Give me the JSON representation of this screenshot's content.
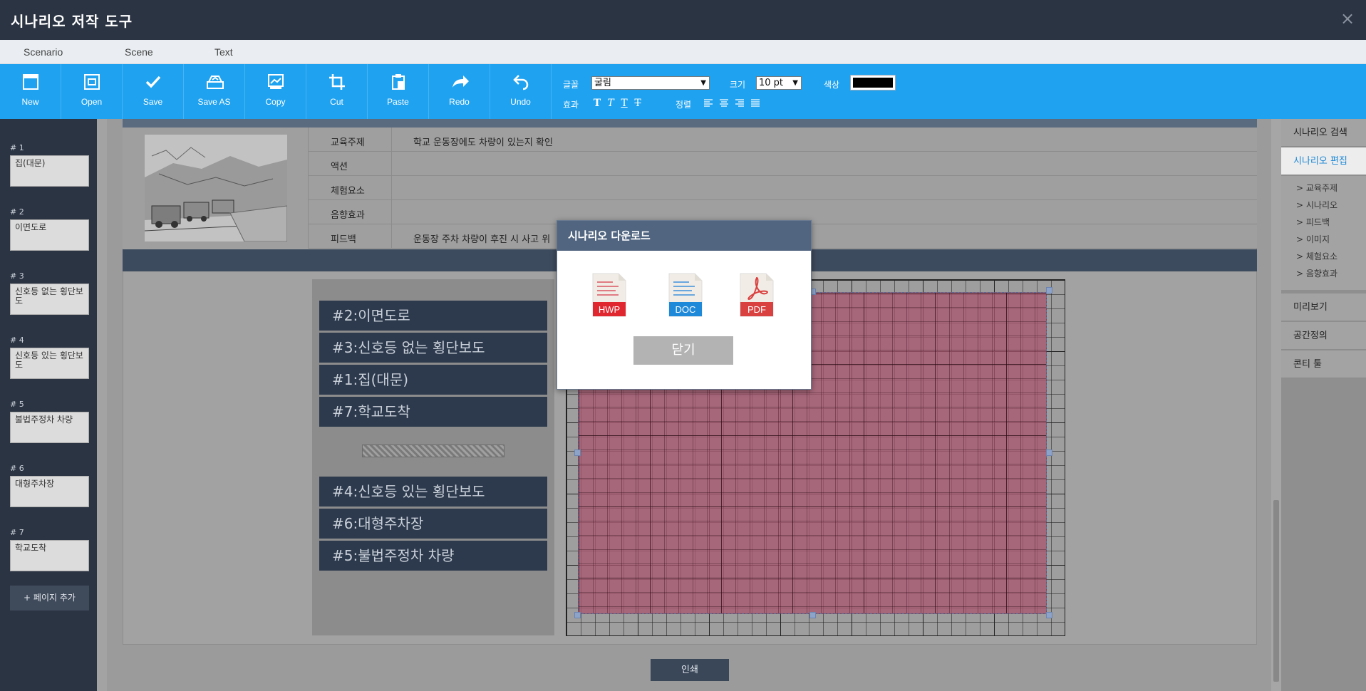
{
  "window": {
    "title": "시나리오 저작 도구",
    "close_symbol": "×"
  },
  "menu": [
    "Scenario",
    "Scene",
    "Text"
  ],
  "toolbar": {
    "buttons": [
      "New",
      "Open",
      "Save",
      "Save AS",
      "Copy",
      "Cut",
      "Paste",
      "Redo",
      "Undo"
    ],
    "font_label": "글꼴",
    "font_value": "굴림",
    "size_label": "크기",
    "size_value": "10 pt",
    "color_label": "색상",
    "color_value": "#000000",
    "effect_label": "효과",
    "align_label": "정렬"
  },
  "scenes": [
    {
      "num": "# 1",
      "name": "집(대문)"
    },
    {
      "num": "# 2",
      "name": "이면도로"
    },
    {
      "num": "# 3",
      "name": "신호등 없는 횡단보도"
    },
    {
      "num": "# 4",
      "name": "신호등 있는 횡단보도"
    },
    {
      "num": "# 5",
      "name": "불법주정차 차량"
    },
    {
      "num": "# 6",
      "name": "대형주차장"
    },
    {
      "num": "# 7",
      "name": "학교도착"
    }
  ],
  "add_page_label": "+ 페이지 추가",
  "info": [
    {
      "key": "교육주제",
      "value": "학교 운동장에도 차량이 있는지 확인"
    },
    {
      "key": "액션",
      "value": ""
    },
    {
      "key": "체험요소",
      "value": ""
    },
    {
      "key": "음향효과",
      "value": ""
    },
    {
      "key": "피드백",
      "value": "운동장 주차 차량이 후진 시 사고 위"
    }
  ],
  "order_top": [
    "#2:이면도로",
    "#3:신호등 없는 횡단보도",
    "#1:집(대문)",
    "#7:학교도착"
  ],
  "order_bottom": [
    "#4:신호등 있는 횡단보도",
    "#6:대형주차장",
    "#5:불법주정차 차량"
  ],
  "print_label": "인쇄",
  "right_menu": {
    "search": "시나리오 검색",
    "edit": "시나리오 편집",
    "sub_items": [
      "> 교육주제",
      "> 시나리오",
      "> 피드백",
      "> 이미지",
      "> 체험요소",
      "> 음향효과"
    ],
    "preview": "미리보기",
    "space": "공간정의",
    "conti": "콘티 툴"
  },
  "modal": {
    "title": "시나리오 다운로드",
    "formats": [
      "HWP",
      "DOC",
      "PDF"
    ],
    "close_label": "닫기"
  },
  "colors": {
    "titlebar": "#2b3443",
    "toolbar": "#1fa2f0",
    "hwp": "#e0262f",
    "doc": "#1e88d9",
    "pdf": "#d94140"
  }
}
